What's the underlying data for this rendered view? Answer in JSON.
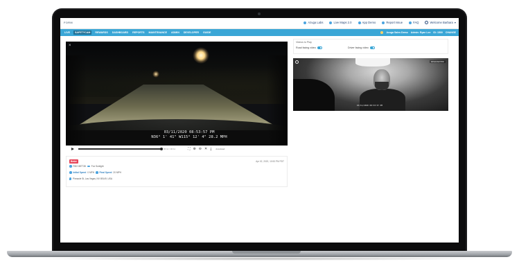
{
  "app": {
    "brand": "FORM"
  },
  "toplinks": [
    {
      "label": "Azuga Labs",
      "icon": "lab-icon"
    },
    {
      "label": "Live Maps 2.0",
      "icon": "map-icon"
    },
    {
      "label": "App Demo",
      "icon": "app-icon"
    },
    {
      "label": "Report Issue",
      "icon": "issue-icon"
    },
    {
      "label": "FAQ",
      "icon": "faq-icon"
    },
    {
      "label": "Welcome Barbara",
      "icon": "user-icon"
    }
  ],
  "nav": {
    "items": [
      "LIVE",
      "SAFETYCAM",
      "REWARDS",
      "DASHBOARD",
      "REPORTS",
      "MAINTENANCE",
      "ADMIN",
      "DEVELOPER",
      "GUIDE"
    ],
    "active_index": 1,
    "right": {
      "company": "Azuga Sales Demo",
      "account": "Admin: Ryan Lee",
      "id": "ID: 1500",
      "change": "CHANGE"
    }
  },
  "main_video": {
    "overlay_date": "03/11/2020 08:53:57 PM",
    "overlay_coord": "N36° 1' 41\" W115° 12' 4\" 28.2 MPH"
  },
  "controls": {
    "time": "00:11 / 00:11",
    "download_label": "download",
    "progress": 1.0
  },
  "event": {
    "badge": "Brake",
    "timestamp": "Apr 02, 2020, 10:53 PM PDT",
    "vehicle": "RDX 887738",
    "driver": "Fox Sunlight",
    "initial_speed_label": "Initial Speed",
    "initial_speed": "0 MPH",
    "final_speed_label": "Final Speed",
    "final_speed": "20 MPH",
    "address": "Pinnacle St, Las Vegas, NV 89149, USA"
  },
  "videos_to_play": {
    "title": "Videos to Play",
    "road_label": "Road facing video",
    "driver_label": "Driver facing video",
    "road_enabled": true,
    "driver_enabled": true
  },
  "driver_video": {
    "badge": "DASHCAM PRO",
    "overlay": "03/11/2020 08:53:57 PM"
  }
}
